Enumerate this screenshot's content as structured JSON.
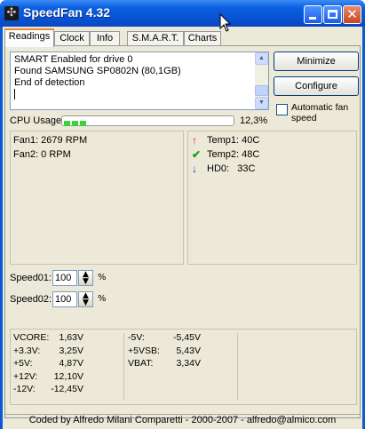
{
  "window": {
    "title": "SpeedFan 4.32"
  },
  "tabs": [
    {
      "label": "Readings",
      "active": true
    },
    {
      "label": "Clock"
    },
    {
      "label": "Info"
    },
    {
      "label": "S.M.A.R.T."
    },
    {
      "label": "Charts"
    }
  ],
  "log": {
    "lines": [
      "SMART Enabled for drive 0",
      "Found SAMSUNG SP0802N (80,1GB)",
      "End of detection"
    ]
  },
  "buttons": {
    "minimize": "Minimize",
    "configure": "Configure"
  },
  "auto_fan": {
    "label": "Automatic fan speed",
    "checked": false
  },
  "cpu": {
    "label": "CPU Usage",
    "value": "12,3%",
    "fraction": 0.123
  },
  "fans": [
    {
      "label": "Fan1: 2679 RPM"
    },
    {
      "label": "Fan2: 0 RPM"
    }
  ],
  "temps": [
    {
      "name": "Temp1:",
      "value": "40C",
      "icon": "arrow-up-icon",
      "color": "#e8161c"
    },
    {
      "name": "Temp2:",
      "value": "48C",
      "icon": "check-icon",
      "color": "#16a01c"
    },
    {
      "name": "HD0:",
      "value": "33C",
      "icon": "arrow-down-icon",
      "color": "#1a30d8"
    }
  ],
  "speeds": [
    {
      "label": "Speed01:",
      "value": "100",
      "unit": "%"
    },
    {
      "label": "Speed02:",
      "value": "100",
      "unit": "%"
    }
  ],
  "voltages": {
    "col1": [
      {
        "name": "VCORE:",
        "value": "1,63V"
      },
      {
        "name": "+3.3V:",
        "value": "3,25V"
      },
      {
        "name": "+5V:",
        "value": "4,87V"
      },
      {
        "name": "+12V:",
        "value": "12,10V"
      },
      {
        "name": "-12V:",
        "value": "-12,45V"
      }
    ],
    "col2": [
      {
        "name": "-5V:",
        "value": "-5,45V"
      },
      {
        "name": "+5VSB:",
        "value": "5,43V"
      },
      {
        "name": "VBAT:",
        "value": "3,34V"
      }
    ]
  },
  "footer": {
    "text": "Coded by Alfredo Milani Comparetti - 2000-2007 - alfredo@almico.com"
  }
}
